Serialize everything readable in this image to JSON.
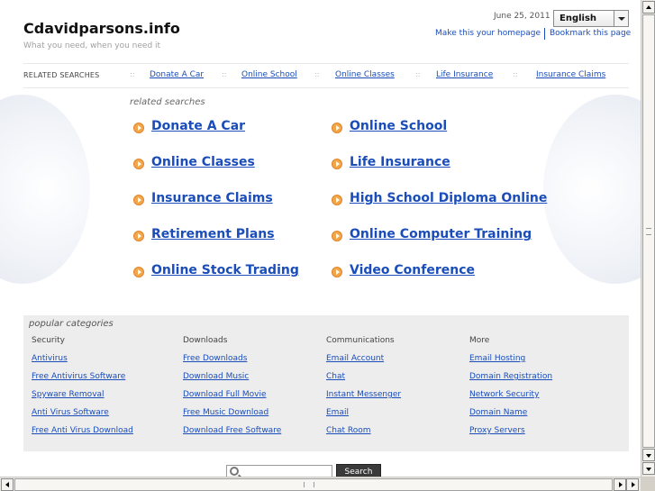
{
  "header": {
    "site_title": "Cdavidparsons.info",
    "tagline": "What you need, when you need it",
    "date": "June 25, 2011",
    "language": "English",
    "make_homepage": "Make this your homepage",
    "bookmark": "Bookmark this page"
  },
  "related_bar": {
    "label": "RELATED SEARCHES",
    "separator": "::",
    "items": [
      "Donate A Car",
      "Online School",
      "Online Classes",
      "Life Insurance",
      "Insurance Claims"
    ]
  },
  "main": {
    "heading": "related searches",
    "links": [
      "Donate A Car",
      "Online School",
      "Online Classes",
      "Life Insurance",
      "Insurance Claims",
      "High School Diploma Online",
      "Retirement Plans",
      "Online Computer Training",
      "Online Stock Trading",
      "Video Conference"
    ]
  },
  "popular": {
    "heading": "popular categories",
    "columns": [
      {
        "title": "Security",
        "links": [
          "Antivirus",
          "Free Antivirus Software",
          "Spyware Removal",
          "Anti Virus Software",
          "Free Anti Virus Download"
        ]
      },
      {
        "title": "Downloads",
        "links": [
          "Free Downloads",
          "Download Music",
          "Download Full Movie",
          "Free Music Download",
          "Download Free Software"
        ]
      },
      {
        "title": "Communications",
        "links": [
          "Email Account",
          "Chat",
          "Instant Messenger",
          "Email",
          "Chat Room"
        ]
      },
      {
        "title": "More",
        "links": [
          "Email Hosting",
          "Domain Registration",
          "Network Security",
          "Domain Name",
          "Proxy Servers"
        ]
      }
    ]
  },
  "search": {
    "button_label": "Search",
    "value": ""
  },
  "colors": {
    "link": "#1a4dba",
    "arrow": "#f2a64a",
    "panel": "#ededed"
  },
  "icons": [
    "search-icon",
    "arrow-right-icon",
    "chevron-down-icon"
  ]
}
